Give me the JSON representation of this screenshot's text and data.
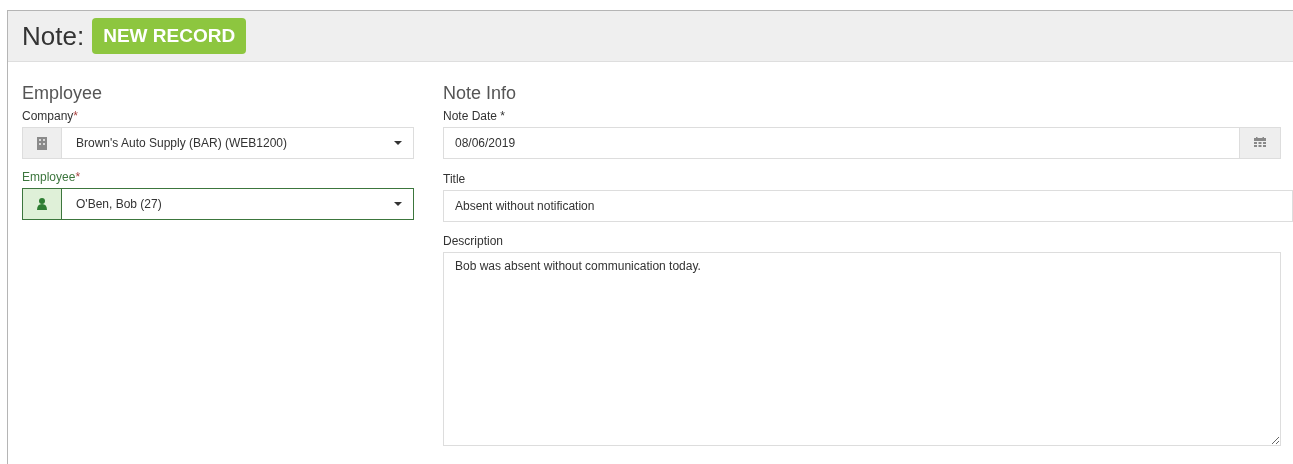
{
  "header": {
    "title": "Note:",
    "badge": "NEW RECORD"
  },
  "employee_section": {
    "heading": "Employee",
    "fields": [
      {
        "label": "Company",
        "required_mark": "*",
        "value": "Brown's Auto Supply (BAR) (WEB1200)",
        "highlighted": false
      },
      {
        "label": "Employee",
        "required_mark": "*",
        "value": "O'Ben, Bob (27)",
        "highlighted": true
      }
    ]
  },
  "note_info": {
    "heading": "Note Info",
    "note_date": {
      "label": "Note Date *",
      "value": "08/06/2019"
    },
    "title": {
      "label": "Title",
      "value": "Absent without notification"
    },
    "description": {
      "label": "Description",
      "value": "Bob was absent without communication today."
    }
  }
}
